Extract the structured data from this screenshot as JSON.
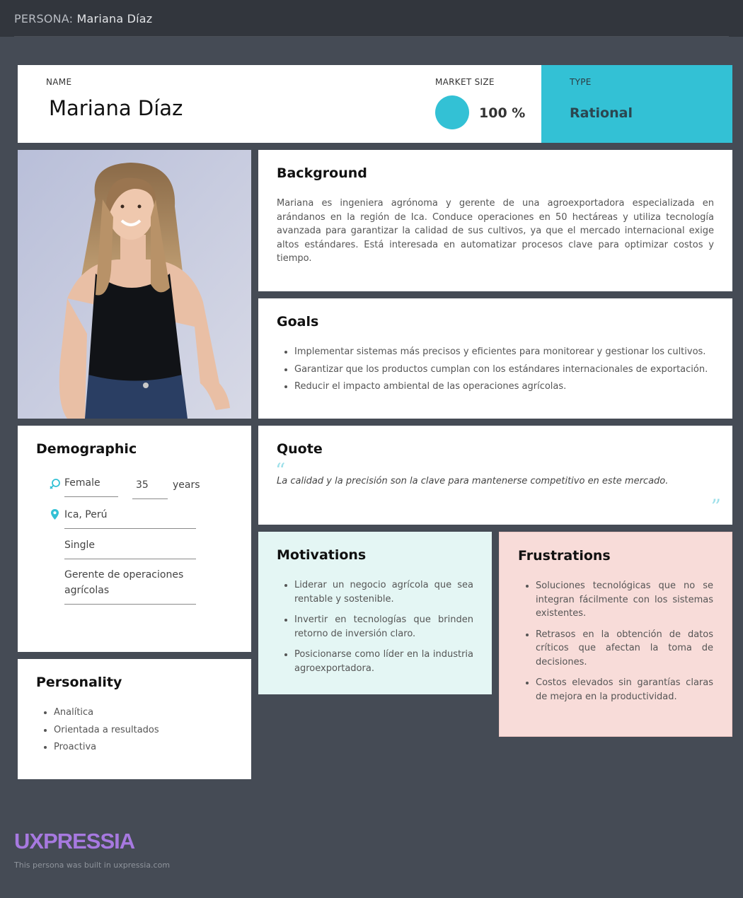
{
  "topbar": {
    "prefix": "PERSONA:",
    "name": "Mariana Díaz"
  },
  "header": {
    "name_label": "NAME",
    "name": "Mariana Díaz",
    "market_size_label": "MARKET SIZE",
    "market_size_value": "100 %",
    "market_size_fraction": 1.0,
    "type_label": "TYPE",
    "type_value": "Rational",
    "accent_color": "#33c1d5"
  },
  "background": {
    "title": "Background",
    "text": "Mariana es ingeniera agrónoma y gerente de una agroexportadora especializada en arándanos en la región de Ica. Conduce operaciones en 50 hectáreas y utiliza tecnología avanzada para garantizar la calidad de sus cultivos, ya que el mercado internacional exige altos estándares. Está interesada en automatizar procesos clave para optimizar costos y tiempo."
  },
  "goals": {
    "title": "Goals",
    "items": [
      "Implementar sistemas más precisos y eficientes para monitorear y gestionar los cultivos.",
      "Garantizar que los productos cumplan con los estándares internacionales de exportación.",
      "Reducir el impacto ambiental de las operaciones agrícolas."
    ]
  },
  "demographic": {
    "title": "Demographic",
    "gender": "Female",
    "gender_icon": "gender-female-icon",
    "age": "35",
    "age_unit": "years",
    "location": "Ica, Perú",
    "location_icon": "map-pin-icon",
    "status": "Single",
    "occupation": "Gerente de operaciones agrícolas"
  },
  "quote": {
    "title": "Quote",
    "text": "La calidad y la precisión son la clave para mantenerse competitivo en este mercado."
  },
  "personality": {
    "title": "Personality",
    "items": [
      "Analítica",
      "Orientada a resultados",
      "Proactiva"
    ]
  },
  "motivations": {
    "title": "Motivations",
    "background_color": "#e4f6f4",
    "items": [
      "Liderar un negocio agrícola que sea rentable y sostenible.",
      "Invertir en tecnologías que brinden retorno de inversión claro.",
      "Posicionarse como líder en la industria agroexportadora."
    ]
  },
  "frustrations": {
    "title": "Frustrations",
    "background_color": "#f8dcd9",
    "items": [
      "Soluciones tecnológicas que no se integran fácilmente con los sistemas existentes.",
      "Retrasos en la obtención de datos críticos que afectan la toma de decisiones.",
      "Costos elevados sin garantías claras de mejora en la productividad."
    ]
  },
  "footer": {
    "brand": "UXPRESSIA",
    "note": "This persona was built in uxpressia.com",
    "brand_color": "#a779e0"
  }
}
